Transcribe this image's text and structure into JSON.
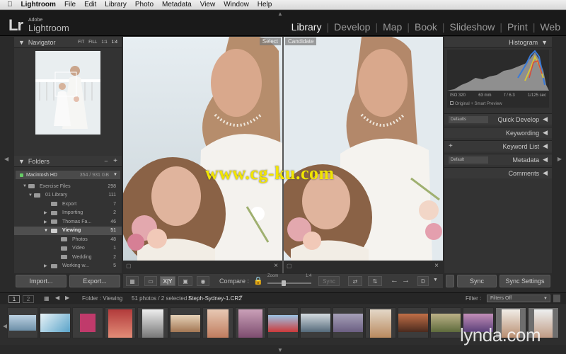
{
  "menubar": {
    "apple": "",
    "items": [
      "Lightroom",
      "File",
      "Edit",
      "Library",
      "Photo",
      "Metadata",
      "View",
      "Window",
      "Help"
    ]
  },
  "identity": {
    "logo": "Lr",
    "brand_small": "Adobe",
    "brand": "Lightroom"
  },
  "modules": [
    "Library",
    "Develop",
    "Map",
    "Book",
    "Slideshow",
    "Print",
    "Web"
  ],
  "navigator": {
    "title": "Navigator",
    "zoom_options": [
      "FIT",
      "FILL",
      "1:1",
      "1:4"
    ]
  },
  "folders": {
    "title": "Folders",
    "add": "+",
    "volume": {
      "name": "Macintosh HD",
      "size": "354 / 931 GB"
    },
    "rows": [
      {
        "name": "Exercise Files",
        "count": "298"
      },
      {
        "name": "01 Library",
        "count": "111"
      },
      {
        "name": "Export",
        "count": "7"
      },
      {
        "name": "Importing",
        "count": "2"
      },
      {
        "name": "Thomas Fa...",
        "count": "46"
      },
      {
        "name": "Viewing",
        "count": "51"
      },
      {
        "name": "Photos",
        "count": "48"
      },
      {
        "name": "Video",
        "count": "1"
      },
      {
        "name": "Wedding",
        "count": "2"
      },
      {
        "name": "Working w...",
        "count": "5"
      }
    ]
  },
  "left_buttons": {
    "import": "Import...",
    "export": "Export..."
  },
  "compare": {
    "select_tag": "Select",
    "candidate_tag": "Candidate"
  },
  "watermark": "www.cg-ku.com",
  "toolbar": {
    "compare_label": "Compare :",
    "zoom_label": "Zoom",
    "zoom_value": "1:4",
    "sync": "Sync",
    "xy": "X|Y",
    "done": "D"
  },
  "right_panel": {
    "histogram_title": "Histogram",
    "histo_info": [
      "ISO 320",
      "63 mm",
      "f / 6.3",
      "1/125 sec"
    ],
    "preview_status": "Original + Smart Preview",
    "sections": [
      {
        "title": "Quick Develop",
        "mini": "Defaults"
      },
      {
        "title": "Keywording",
        "mini": ""
      },
      {
        "title": "Keyword List",
        "mini": "+"
      },
      {
        "title": "Metadata",
        "mini": "Default"
      },
      {
        "title": "Comments",
        "mini": ""
      }
    ],
    "sync": "Sync",
    "sync_settings": "Sync Settings"
  },
  "filmstrip": {
    "page1": "1",
    "page2": "2",
    "folder": "Folder : Viewing",
    "summary": "51 photos / 2 selected /",
    "filename": "Steph-Sydney-1.CR2",
    "filter_label": "Filter :",
    "filter_value": "Filters Off"
  },
  "lynda": "lynda.com",
  "colors": {
    "accent": "#f2f2f2",
    "panel": "#333333",
    "watermark": "#f2e500"
  }
}
